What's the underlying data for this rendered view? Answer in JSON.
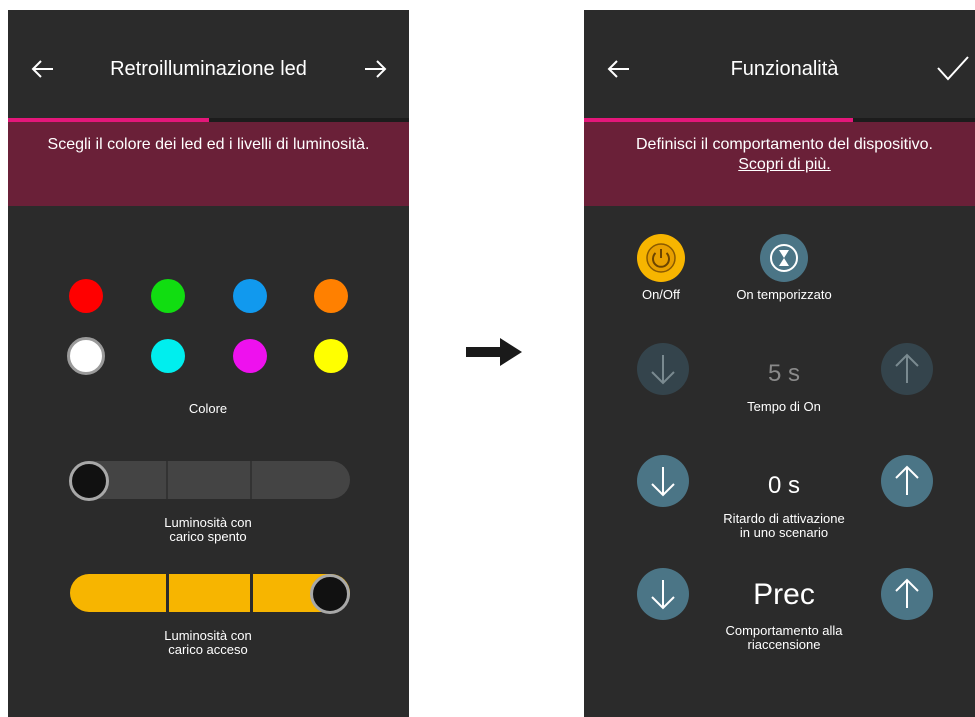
{
  "left_screen": {
    "title": "Retroilluminazione led",
    "progress": 0.5,
    "banner_text": "Scegli il colore dei led ed i livelli di luminosità.",
    "color_label": "Colore",
    "colors": [
      "#ff0000",
      "#11dd11",
      "#1199ee",
      "#ff8000",
      "#ffffff",
      "#00eeee",
      "#ee11ee",
      "#ffff00"
    ],
    "selected_color": "#ffffff",
    "slider_off": {
      "label_line1": "Luminosità con",
      "label_line2": "carico spento",
      "level": 0
    },
    "slider_on": {
      "label_line1": "Luminosità con",
      "label_line2": "carico acceso",
      "level": 1
    }
  },
  "right_screen": {
    "title": "Funzionalità",
    "progress": 0.67,
    "banner_line1": "Definisci il comportamento del dispositivo.",
    "banner_link": "Scopri di più.",
    "modes": [
      {
        "label": "On/Off",
        "icon": "power-icon",
        "active": true
      },
      {
        "label": "On temporizzato",
        "icon": "hourglass-icon",
        "active": false
      }
    ],
    "settings": [
      {
        "value": "5 s",
        "label_line1": "Tempo di On",
        "label_line2": "",
        "enabled": false
      },
      {
        "value": "0 s",
        "label_line1": "Ritardo di attivazione",
        "label_line2": "in uno scenario",
        "enabled": true
      },
      {
        "value": "Prec",
        "label_line1": "Comportamento alla",
        "label_line2": "riaccensione",
        "enabled": true
      }
    ]
  },
  "colors": {
    "screen_bg": "#2b2b2b",
    "banner_bg": "#6a2038",
    "progress": "#e4177a",
    "accent_yellow": "#f7b500",
    "button_teal": "#4b7586",
    "button_disabled": "#34444c",
    "slider_track": "#444444"
  }
}
